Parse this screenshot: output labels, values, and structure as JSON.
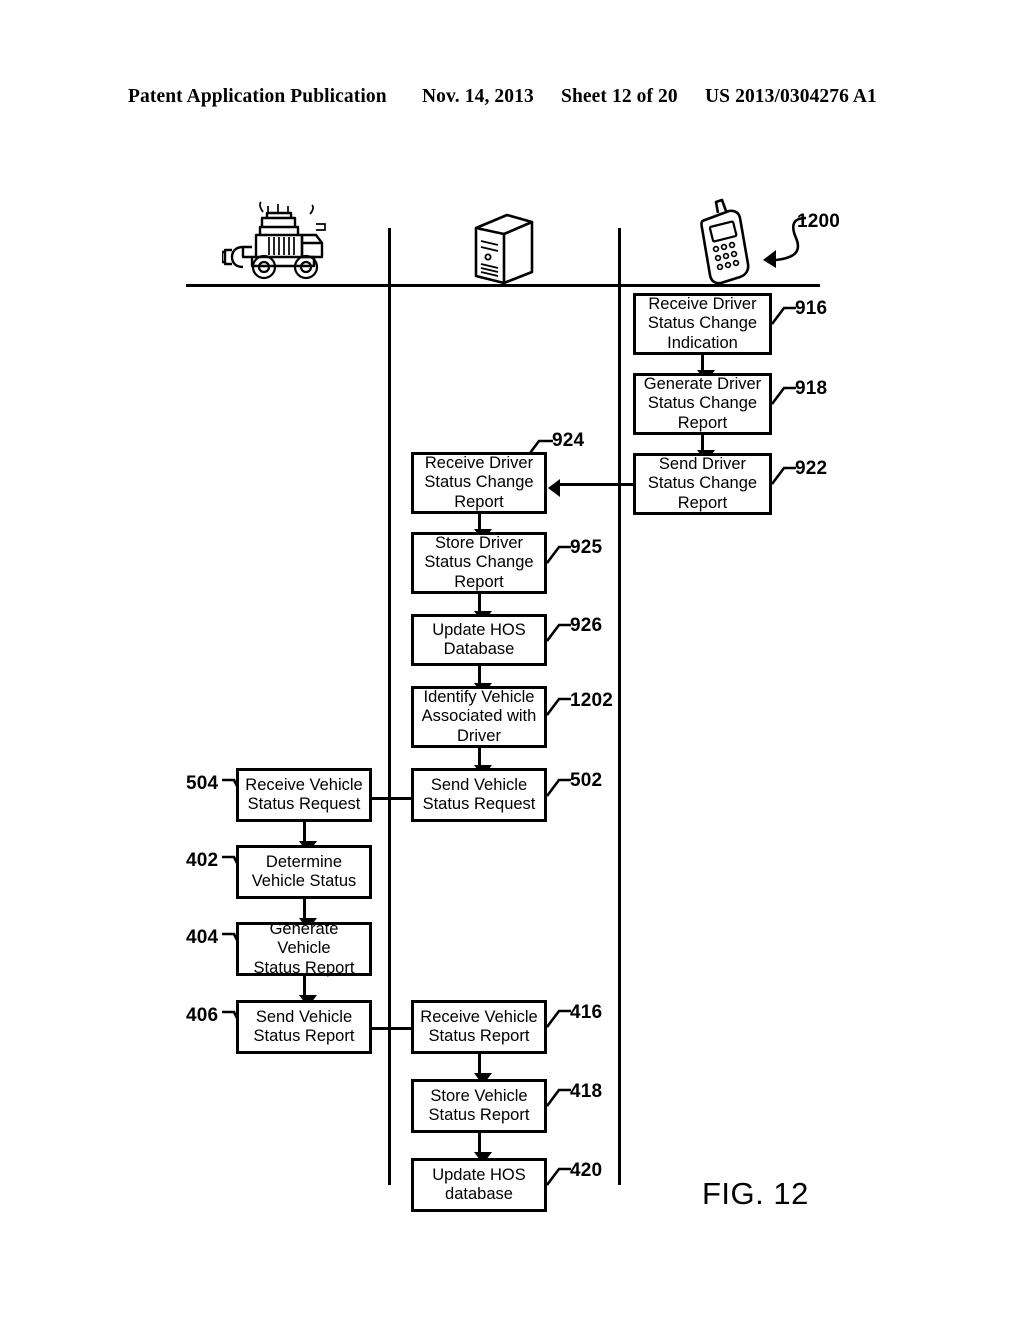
{
  "header": {
    "publication": "Patent Application Publication",
    "date": "Nov. 14, 2013",
    "sheet": "Sheet 12 of 20",
    "number": "US 2013/0304276 A1"
  },
  "figure": {
    "caption": "FIG. 12",
    "overall_ref": "1200"
  },
  "lanes": [
    {
      "id": "vehicle",
      "icon": "truck-icon"
    },
    {
      "id": "server",
      "icon": "server-icon"
    },
    {
      "id": "mobile",
      "icon": "mobile-phone-icon"
    }
  ],
  "boxes": {
    "b916": {
      "text": "Receive Driver\nStatus Change\nIndication",
      "ref": "916"
    },
    "b918": {
      "text": "Generate Driver\nStatus Change\nReport",
      "ref": "918"
    },
    "b922": {
      "text": "Send Driver\nStatus Change\nReport",
      "ref": "922"
    },
    "b924": {
      "text": "Receive Driver\nStatus Change\nReport",
      "ref": "924"
    },
    "b925": {
      "text": "Store Driver\nStatus Change\nReport",
      "ref": "925"
    },
    "b926": {
      "text": "Update HOS\nDatabase",
      "ref": "926"
    },
    "b1202": {
      "text": "Identify Vehicle\nAssociated with\nDriver",
      "ref": "1202"
    },
    "b502": {
      "text": "Send Vehicle\nStatus Request",
      "ref": "502"
    },
    "b504": {
      "text": "Receive Vehicle\nStatus Request",
      "ref": "504"
    },
    "b402": {
      "text": "Determine\nVehicle Status",
      "ref": "402"
    },
    "b404": {
      "text": "Generate Vehicle\nStatus Report",
      "ref": "404"
    },
    "b406": {
      "text": "Send Vehicle\nStatus Report",
      "ref": "406"
    },
    "b416": {
      "text": "Receive Vehicle\nStatus Report",
      "ref": "416"
    },
    "b418": {
      "text": "Store Vehicle\nStatus Report",
      "ref": "418"
    },
    "b420": {
      "text": "Update HOS\ndatabase",
      "ref": "420"
    }
  },
  "colors": {
    "ink": "#000000",
    "paper": "#ffffff"
  }
}
